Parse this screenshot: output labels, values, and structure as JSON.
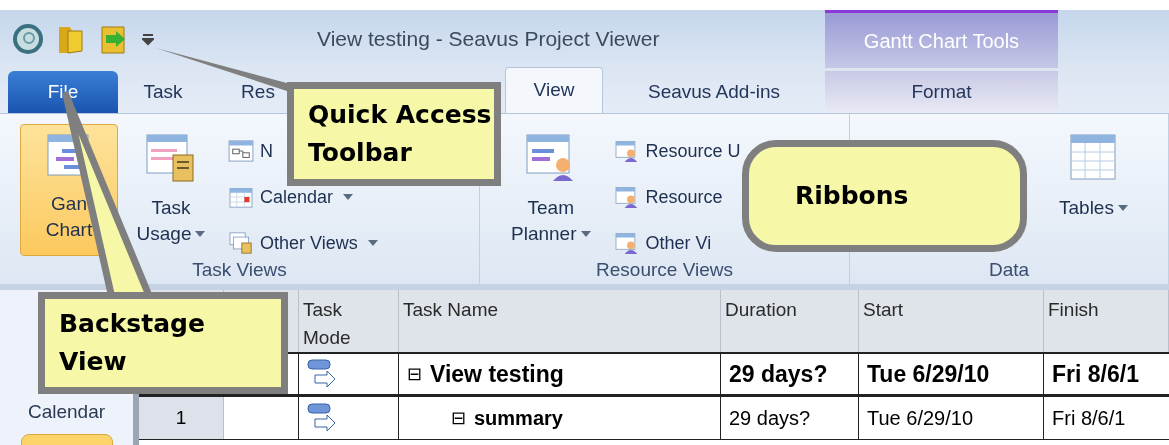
{
  "title_bar": {
    "title": "View testing - Seavus Project Viewer",
    "contextual_tab": "Gantt Chart Tools"
  },
  "tabs": [
    {
      "label": "File",
      "kind": "file",
      "selected": false
    },
    {
      "label": "Task",
      "kind": "tab",
      "selected": false
    },
    {
      "label": "Res",
      "kind": "tab",
      "selected": false
    },
    {
      "label": "View",
      "kind": "tab",
      "selected": true
    },
    {
      "label": "Seavus Add-ins",
      "kind": "tab",
      "selected": false
    },
    {
      "label": "Format",
      "kind": "contextual",
      "selected": false
    }
  ],
  "ribbon_groups": [
    {
      "title": "Task Views",
      "items": [
        {
          "kind": "large",
          "lines": [
            "Gan",
            "Chart"
          ],
          "selected": true
        },
        {
          "kind": "large",
          "lines": [
            "Task",
            "Usage"
          ],
          "selected": false,
          "dropdown": true
        },
        {
          "kind": "small_stack",
          "entries": [
            {
              "label": "N"
            },
            {
              "label": "Calendar",
              "dropdown": true
            },
            {
              "label": "Other Views",
              "dropdown": true
            }
          ]
        }
      ]
    },
    {
      "title": "Resource Views",
      "items": [
        {
          "kind": "large",
          "lines": [
            "Team",
            "Planner"
          ],
          "selected": false,
          "dropdown": true
        },
        {
          "kind": "small_stack",
          "entries": [
            {
              "label": "Resource U"
            },
            {
              "label": "Resource"
            },
            {
              "label": "Other Vi"
            }
          ]
        }
      ]
    },
    {
      "title": "Data",
      "items": [
        {
          "kind": "large",
          "lines": [
            "Tables"
          ],
          "selected": false,
          "dropdown": true
        }
      ]
    }
  ],
  "view_bar": {
    "label": "Calendar"
  },
  "table": {
    "columns": [
      "Task Mode",
      "Task Name",
      "Duration",
      "Start",
      "Finish"
    ],
    "rows": [
      {
        "id": "",
        "kind": "project",
        "toggle": "⊟",
        "name": "View testing",
        "duration": "29 days?",
        "start": "Tue 6/29/10",
        "finish": "Fri 8/6/1",
        "children": [
          {
            "id": "1",
            "kind": "summary",
            "toggle": "⊟",
            "name": "summary",
            "duration": "29 days?",
            "start": "Tue 6/29/10",
            "finish": "Fri 8/6/1"
          }
        ]
      }
    ]
  },
  "callouts": [
    {
      "kind": "box",
      "text": "Quick Access Toolbar"
    },
    {
      "kind": "rounded",
      "text": "Ribbons"
    },
    {
      "kind": "box",
      "text": "Backstage View"
    }
  ]
}
